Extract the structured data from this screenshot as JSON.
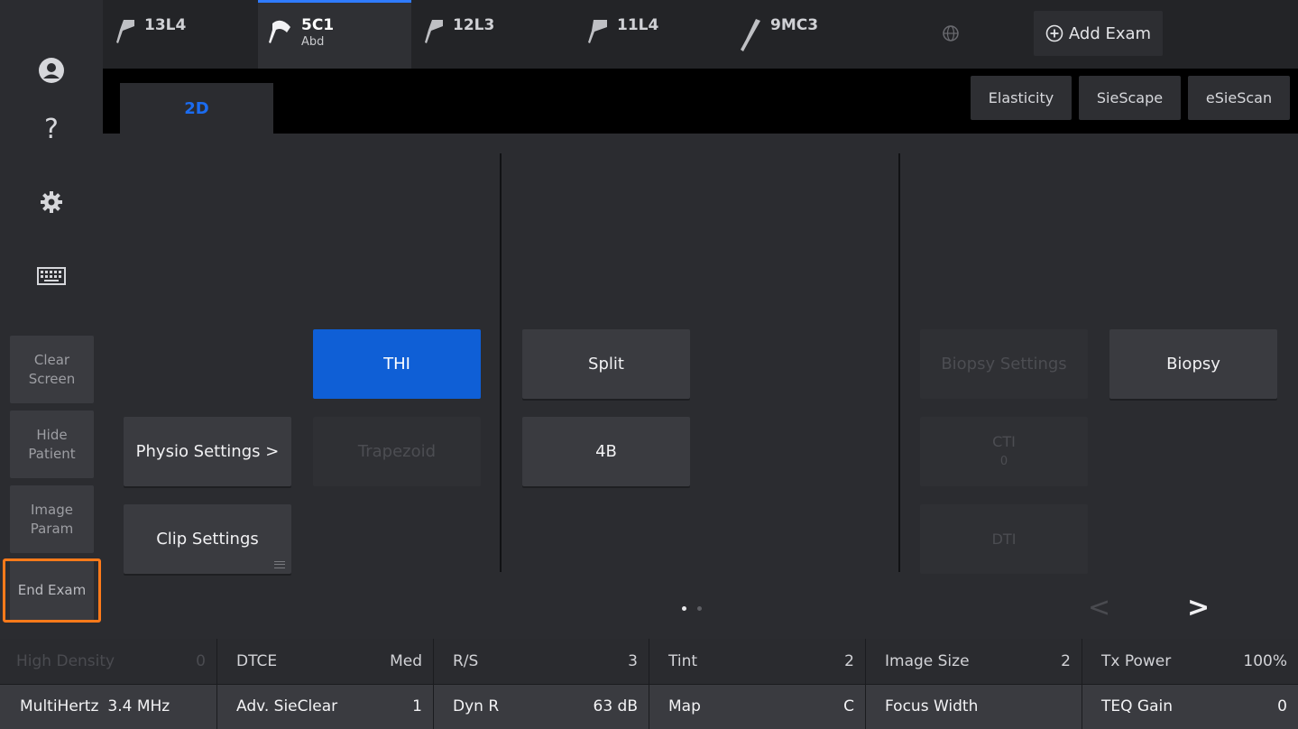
{
  "sidebar": {
    "icons": [
      "user-icon",
      "help-icon",
      "gear-icon",
      "keyboard-icon"
    ],
    "help_glyph": "?",
    "buttons": {
      "clear_screen": "Clear\nScreen",
      "hide_patient": "Hide\nPatient",
      "image_param": "Image\nParam",
      "end_exam": "End Exam"
    }
  },
  "probes": [
    {
      "name": "13L4",
      "sub": ""
    },
    {
      "name": "5C1",
      "sub": "Abd"
    },
    {
      "name": "12L3",
      "sub": ""
    },
    {
      "name": "11L4",
      "sub": ""
    },
    {
      "name": "9MC3",
      "sub": ""
    }
  ],
  "active_probe": "5C1",
  "add_exam_label": "Add Exam",
  "tabs": {
    "active": "2D",
    "modes": [
      "Elasticity",
      "SieScape",
      "eSieScan"
    ]
  },
  "panel": {
    "physio_settings": "Physio Settings >",
    "clip_settings": "Clip Settings",
    "thi": "THI",
    "trapezoid": "Trapezoid",
    "split": "Split",
    "four_b": "4B",
    "biopsy_settings": "Biopsy Settings",
    "biopsy": "Biopsy",
    "cti": "CTI",
    "cti_value": "0",
    "dti": "DTI"
  },
  "pager": {
    "pages": 2,
    "current": 1,
    "prev": "<",
    "next": ">"
  },
  "params": {
    "row1": [
      {
        "label": "High Density",
        "value": "0",
        "state": "disabled"
      },
      {
        "label": "DTCE",
        "value": "Med"
      },
      {
        "label": "R/S",
        "value": "3"
      },
      {
        "label": "Tint",
        "value": "2"
      },
      {
        "label": "Image Size",
        "value": "2"
      },
      {
        "label": "Tx Power",
        "value": "100%"
      }
    ],
    "row2": [
      {
        "label": "MultiHertz",
        "value": "3.4 MHz"
      },
      {
        "label": "Adv. SieClear",
        "value": "1"
      },
      {
        "label": "Dyn R",
        "value": "63 dB"
      },
      {
        "label": "Map",
        "value": "C"
      },
      {
        "label": "Focus Width",
        "value": "",
        "state": "disabled"
      },
      {
        "label": "TEQ Gain",
        "value": "0"
      }
    ]
  },
  "colors": {
    "accent": "#0f5fd6",
    "tab_active_text": "#1b6cf0",
    "highlight": "#ff7a1a"
  }
}
